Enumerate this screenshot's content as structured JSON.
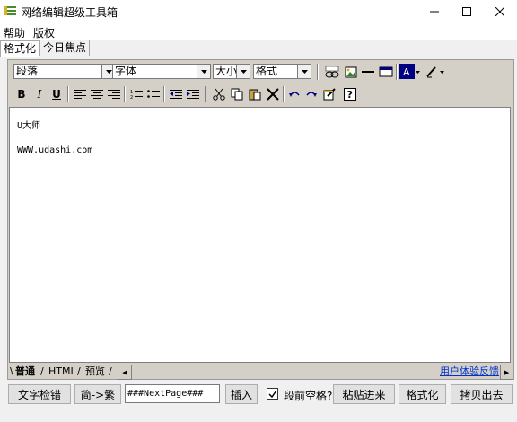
{
  "window": {
    "title": "网络编辑超级工具箱"
  },
  "menu": {
    "items": [
      "帮助",
      "版权"
    ]
  },
  "top_tabs": [
    "格式化",
    "今日焦点"
  ],
  "toolbar": {
    "selects": [
      "段落",
      "字体",
      "大小",
      "格式"
    ]
  },
  "editor": {
    "lines": [
      "U大师",
      "WWW.udashi.com"
    ]
  },
  "bottom_tabs": [
    "普通",
    "HTML",
    "预览"
  ],
  "feedback_link": "用户体验反馈",
  "actions": {
    "spellcheck": "文字检错",
    "convert": "简->繁",
    "nextpage_value": "###NextPage###",
    "insert": "插入",
    "indent_label": "段前空格?",
    "paste": "粘贴进来",
    "format": "格式化",
    "copyout": "拷贝出去"
  },
  "colors": {
    "accent": "#000080"
  }
}
